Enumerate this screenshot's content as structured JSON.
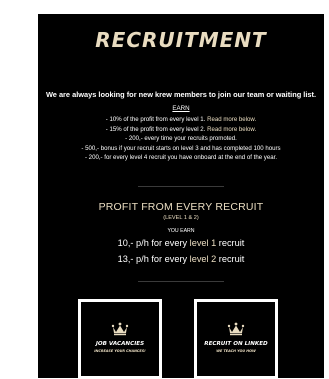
{
  "header": {
    "title": "RECRUITMENT"
  },
  "intro": {
    "text": "We are always looking for new krew members to join our team or waiting list.",
    "earn_label": "EARN"
  },
  "earn_items": [
    {
      "text": "- 10% of the profit from every level 1. ",
      "link": "Read more below."
    },
    {
      "text": "- 15% of the profit from every level 2. ",
      "link": "Read more below."
    },
    {
      "text": "- 200,- every time your recruits promoted.",
      "link": ""
    },
    {
      "text": "- 500,- bonus if your recruit starts on level 3 and has completed 100 hours",
      "link": ""
    },
    {
      "text": "- 200,- for every level 4 recruit you have onboard at the end of the year.",
      "link": ""
    }
  ],
  "profit": {
    "title": "PROFIT FROM EVERY RECRUIT",
    "subtitle": "(LEVEL 1 & 2)",
    "you_earn": "YOU EARN",
    "rates": [
      {
        "amount": "10,-",
        "prefix": " p/h for every ",
        "level": "level 1",
        "suffix": " recruit"
      },
      {
        "amount": "13,-",
        "prefix": " p/h for every ",
        "level": "level 2",
        "suffix": " recruit"
      }
    ]
  },
  "cards": [
    {
      "title": "JOB VACANCIES",
      "subtitle": "INCREASE YOUR CHANCES!",
      "icon": "crown-icon"
    },
    {
      "title": "RECRUIT ON LINKED",
      "subtitle": "WE TEACH YOU HOW",
      "icon": "crown-icon"
    }
  ],
  "colors": {
    "background": "#000000",
    "accent": "#e9dcc0",
    "text": "#ffffff"
  }
}
